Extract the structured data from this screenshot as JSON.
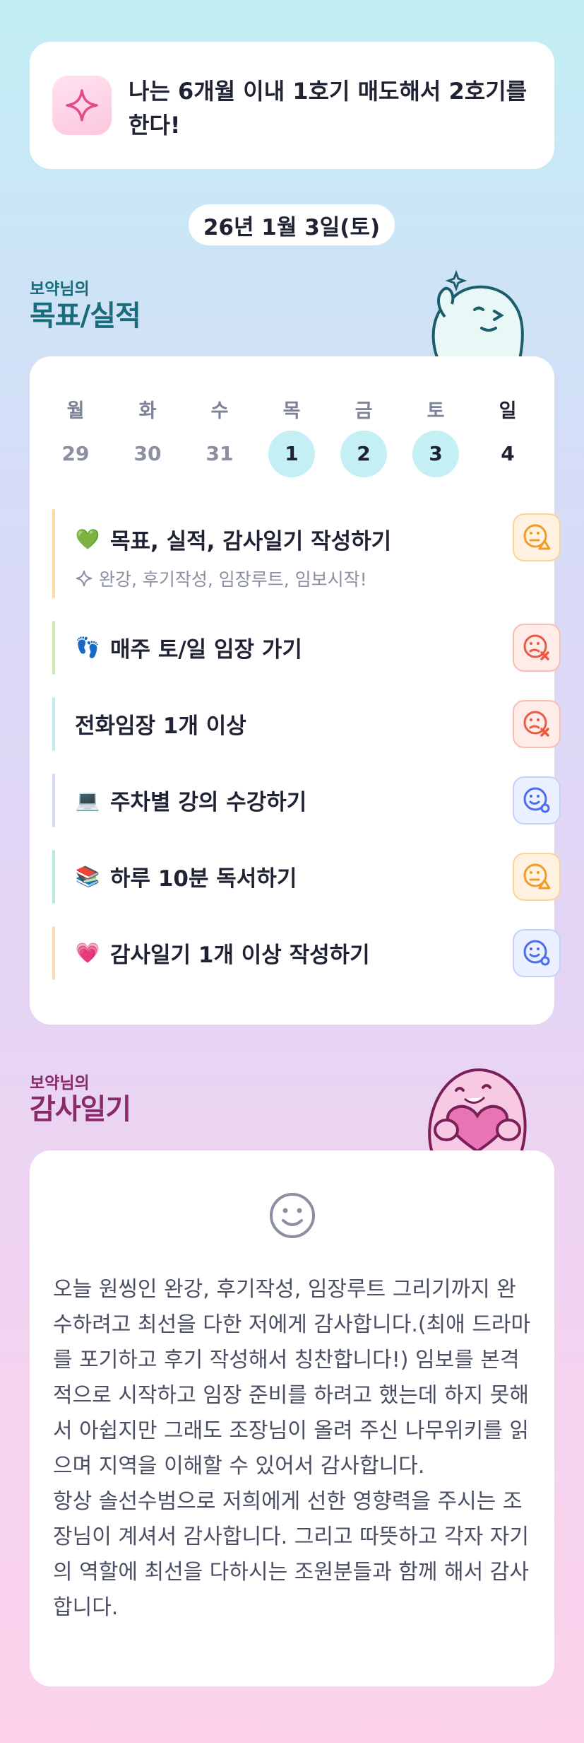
{
  "goal": {
    "icon": "sparkle-icon",
    "text": "나는 6개월 이내 1호기 매도해서 2호기를 한다!"
  },
  "date_label": "26년 1월 3일(토)",
  "perf_section": {
    "subtitle": "보약님의",
    "title": "목표/실적"
  },
  "calendar": {
    "days": [
      {
        "head": "월",
        "num": "29",
        "active": false
      },
      {
        "head": "화",
        "num": "30",
        "active": false
      },
      {
        "head": "수",
        "num": "31",
        "active": false
      },
      {
        "head": "목",
        "num": "1",
        "active": true
      },
      {
        "head": "금",
        "num": "2",
        "active": true
      },
      {
        "head": "토",
        "num": "3",
        "active": true
      },
      {
        "head": "일",
        "num": "4",
        "active": false
      }
    ]
  },
  "tasks": [
    {
      "emoji": "💚",
      "label": "목표, 실적, 감사일기 작성하기",
      "sub": "완강, 후기작성, 임장루트, 임보시작!",
      "status": "triangle",
      "bar_color": "#fcd9a6"
    },
    {
      "emoji": "👣",
      "label": "매주 토/일 임장 가기",
      "status": "x",
      "bar_color": "#c9ecae"
    },
    {
      "emoji": "",
      "label": "전화임장 1개 이상",
      "status": "x",
      "bar_color": "#bfe9f3"
    },
    {
      "emoji": "💻",
      "label": "주차별 강의 수강하기",
      "status": "o",
      "bar_color": "#d4d9f6"
    },
    {
      "emoji": "📚",
      "label": "하루 10분 독서하기",
      "status": "triangle",
      "bar_color": "#b6ecd8"
    },
    {
      "emoji": "💗",
      "label": "감사일기 1개 이상 작성하기",
      "status": "o",
      "bar_color": "#fcdcb5"
    }
  ],
  "gratitude_section": {
    "subtitle": "보약님의",
    "title": "감사일기"
  },
  "gratitude": {
    "icon": "smile-face-icon",
    "text": "오늘 원씽인 완강, 후기작성, 임장루트 그리기까지 완수하려고 최선을 다한 저에게 감사합니다.(최애 드라마를 포기하고 후기 작성해서 칭찬합니다!) 임보를 본격적으로 시작하고 임장 준비를 하려고 했는데 하지 못해서 아쉽지만 그래도 조장님이 올려 주신 나무위키를 읽으며 지역을 이해할 수 있어서 감사합니다.\n항상 솔선수범으로 저희에게 선한 영향력을 주시는 조장님이 계셔서 감사합니다. 그리고 따뜻하고 각자 자기의 역할에 최선을 다하시는 조원분들과 함께 해서 감사합니다."
  },
  "colors": {
    "active_day": "#c4eff4",
    "perf_title": "#1a6c7a",
    "grat_title": "#8a2a6a",
    "status_orange": "#f29a2a",
    "status_red": "#ea5a45",
    "status_blue": "#4a6cf0"
  }
}
